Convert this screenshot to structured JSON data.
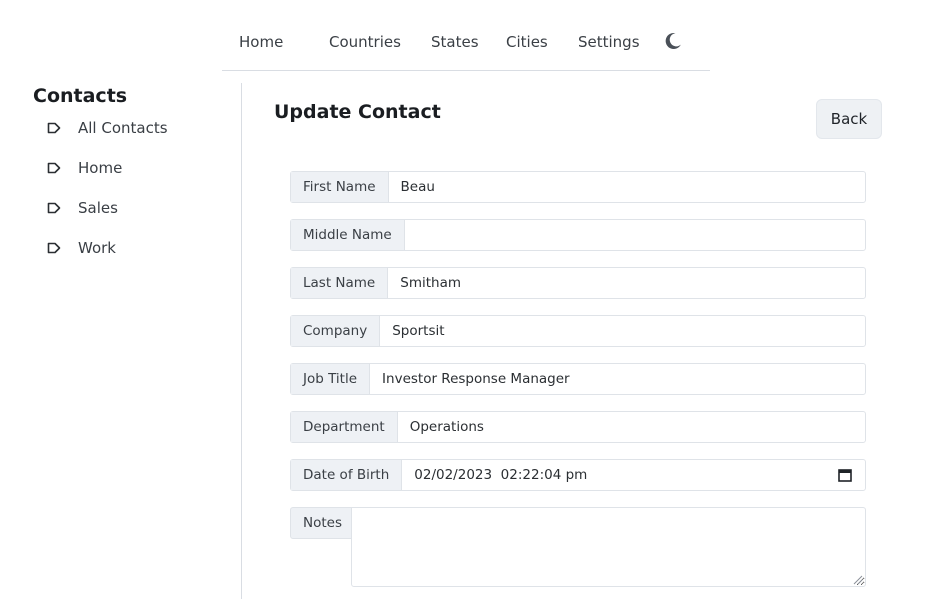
{
  "nav": {
    "items": [
      {
        "label": "Home"
      },
      {
        "label": "Countries"
      },
      {
        "label": "States"
      },
      {
        "label": "Cities"
      },
      {
        "label": "Settings"
      }
    ],
    "theme_icon": "moon-icon"
  },
  "sidebar": {
    "title": "Contacts",
    "items": [
      {
        "label": "All Contacts",
        "icon": "tag-icon"
      },
      {
        "label": "Home",
        "icon": "tag-icon"
      },
      {
        "label": "Sales",
        "icon": "tag-icon"
      },
      {
        "label": "Work",
        "icon": "tag-icon"
      }
    ]
  },
  "main": {
    "title": "Update Contact",
    "back_label": "Back",
    "fields": {
      "first_name": {
        "label": "First Name",
        "value": "Beau"
      },
      "middle_name": {
        "label": "Middle Name",
        "value": ""
      },
      "last_name": {
        "label": "Last Name",
        "value": "Smitham"
      },
      "company": {
        "label": "Company",
        "value": "Sportsit"
      },
      "job_title": {
        "label": "Job Title",
        "value": "Investor Response Manager"
      },
      "department": {
        "label": "Department",
        "value": "Operations"
      },
      "date_of_birth": {
        "label": "Date of Birth",
        "value": "02/02/2023  02:22:04 pm"
      },
      "notes": {
        "label": "Notes",
        "value": ""
      }
    }
  },
  "colors": {
    "label_bg": "#eef1f5",
    "border": "#dfe3e8",
    "button_bg": "#eef1f4"
  }
}
